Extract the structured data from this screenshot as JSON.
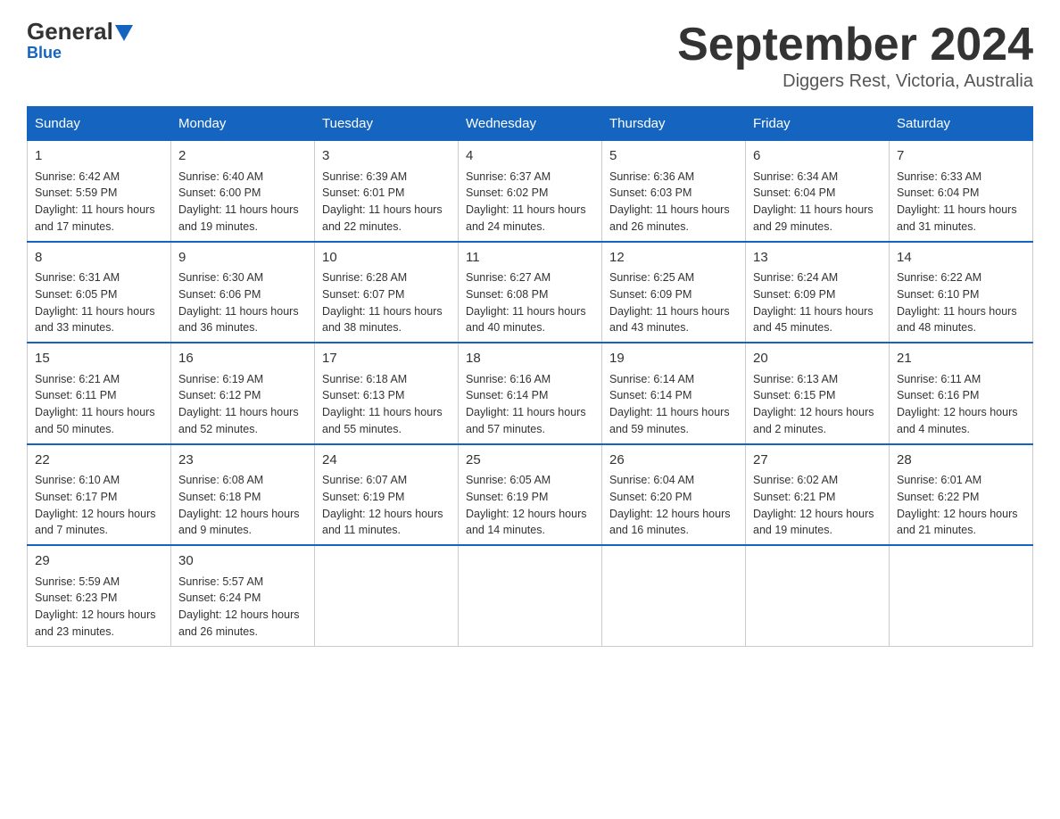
{
  "logo": {
    "general": "General",
    "blue": "Blue"
  },
  "title": "September 2024",
  "subtitle": "Diggers Rest, Victoria, Australia",
  "days_of_week": [
    "Sunday",
    "Monday",
    "Tuesday",
    "Wednesday",
    "Thursday",
    "Friday",
    "Saturday"
  ],
  "weeks": [
    [
      {
        "day": "1",
        "sunrise": "6:42 AM",
        "sunset": "5:59 PM",
        "daylight": "11 hours and 17 minutes."
      },
      {
        "day": "2",
        "sunrise": "6:40 AM",
        "sunset": "6:00 PM",
        "daylight": "11 hours and 19 minutes."
      },
      {
        "day": "3",
        "sunrise": "6:39 AM",
        "sunset": "6:01 PM",
        "daylight": "11 hours and 22 minutes."
      },
      {
        "day": "4",
        "sunrise": "6:37 AM",
        "sunset": "6:02 PM",
        "daylight": "11 hours and 24 minutes."
      },
      {
        "day": "5",
        "sunrise": "6:36 AM",
        "sunset": "6:03 PM",
        "daylight": "11 hours and 26 minutes."
      },
      {
        "day": "6",
        "sunrise": "6:34 AM",
        "sunset": "6:04 PM",
        "daylight": "11 hours and 29 minutes."
      },
      {
        "day": "7",
        "sunrise": "6:33 AM",
        "sunset": "6:04 PM",
        "daylight": "11 hours and 31 minutes."
      }
    ],
    [
      {
        "day": "8",
        "sunrise": "6:31 AM",
        "sunset": "6:05 PM",
        "daylight": "11 hours and 33 minutes."
      },
      {
        "day": "9",
        "sunrise": "6:30 AM",
        "sunset": "6:06 PM",
        "daylight": "11 hours and 36 minutes."
      },
      {
        "day": "10",
        "sunrise": "6:28 AM",
        "sunset": "6:07 PM",
        "daylight": "11 hours and 38 minutes."
      },
      {
        "day": "11",
        "sunrise": "6:27 AM",
        "sunset": "6:08 PM",
        "daylight": "11 hours and 40 minutes."
      },
      {
        "day": "12",
        "sunrise": "6:25 AM",
        "sunset": "6:09 PM",
        "daylight": "11 hours and 43 minutes."
      },
      {
        "day": "13",
        "sunrise": "6:24 AM",
        "sunset": "6:09 PM",
        "daylight": "11 hours and 45 minutes."
      },
      {
        "day": "14",
        "sunrise": "6:22 AM",
        "sunset": "6:10 PM",
        "daylight": "11 hours and 48 minutes."
      }
    ],
    [
      {
        "day": "15",
        "sunrise": "6:21 AM",
        "sunset": "6:11 PM",
        "daylight": "11 hours and 50 minutes."
      },
      {
        "day": "16",
        "sunrise": "6:19 AM",
        "sunset": "6:12 PM",
        "daylight": "11 hours and 52 minutes."
      },
      {
        "day": "17",
        "sunrise": "6:18 AM",
        "sunset": "6:13 PM",
        "daylight": "11 hours and 55 minutes."
      },
      {
        "day": "18",
        "sunrise": "6:16 AM",
        "sunset": "6:14 PM",
        "daylight": "11 hours and 57 minutes."
      },
      {
        "day": "19",
        "sunrise": "6:14 AM",
        "sunset": "6:14 PM",
        "daylight": "11 hours and 59 minutes."
      },
      {
        "day": "20",
        "sunrise": "6:13 AM",
        "sunset": "6:15 PM",
        "daylight": "12 hours and 2 minutes."
      },
      {
        "day": "21",
        "sunrise": "6:11 AM",
        "sunset": "6:16 PM",
        "daylight": "12 hours and 4 minutes."
      }
    ],
    [
      {
        "day": "22",
        "sunrise": "6:10 AM",
        "sunset": "6:17 PM",
        "daylight": "12 hours and 7 minutes."
      },
      {
        "day": "23",
        "sunrise": "6:08 AM",
        "sunset": "6:18 PM",
        "daylight": "12 hours and 9 minutes."
      },
      {
        "day": "24",
        "sunrise": "6:07 AM",
        "sunset": "6:19 PM",
        "daylight": "12 hours and 11 minutes."
      },
      {
        "day": "25",
        "sunrise": "6:05 AM",
        "sunset": "6:19 PM",
        "daylight": "12 hours and 14 minutes."
      },
      {
        "day": "26",
        "sunrise": "6:04 AM",
        "sunset": "6:20 PM",
        "daylight": "12 hours and 16 minutes."
      },
      {
        "day": "27",
        "sunrise": "6:02 AM",
        "sunset": "6:21 PM",
        "daylight": "12 hours and 19 minutes."
      },
      {
        "day": "28",
        "sunrise": "6:01 AM",
        "sunset": "6:22 PM",
        "daylight": "12 hours and 21 minutes."
      }
    ],
    [
      {
        "day": "29",
        "sunrise": "5:59 AM",
        "sunset": "6:23 PM",
        "daylight": "12 hours and 23 minutes."
      },
      {
        "day": "30",
        "sunrise": "5:57 AM",
        "sunset": "6:24 PM",
        "daylight": "12 hours and 26 minutes."
      },
      null,
      null,
      null,
      null,
      null
    ]
  ]
}
